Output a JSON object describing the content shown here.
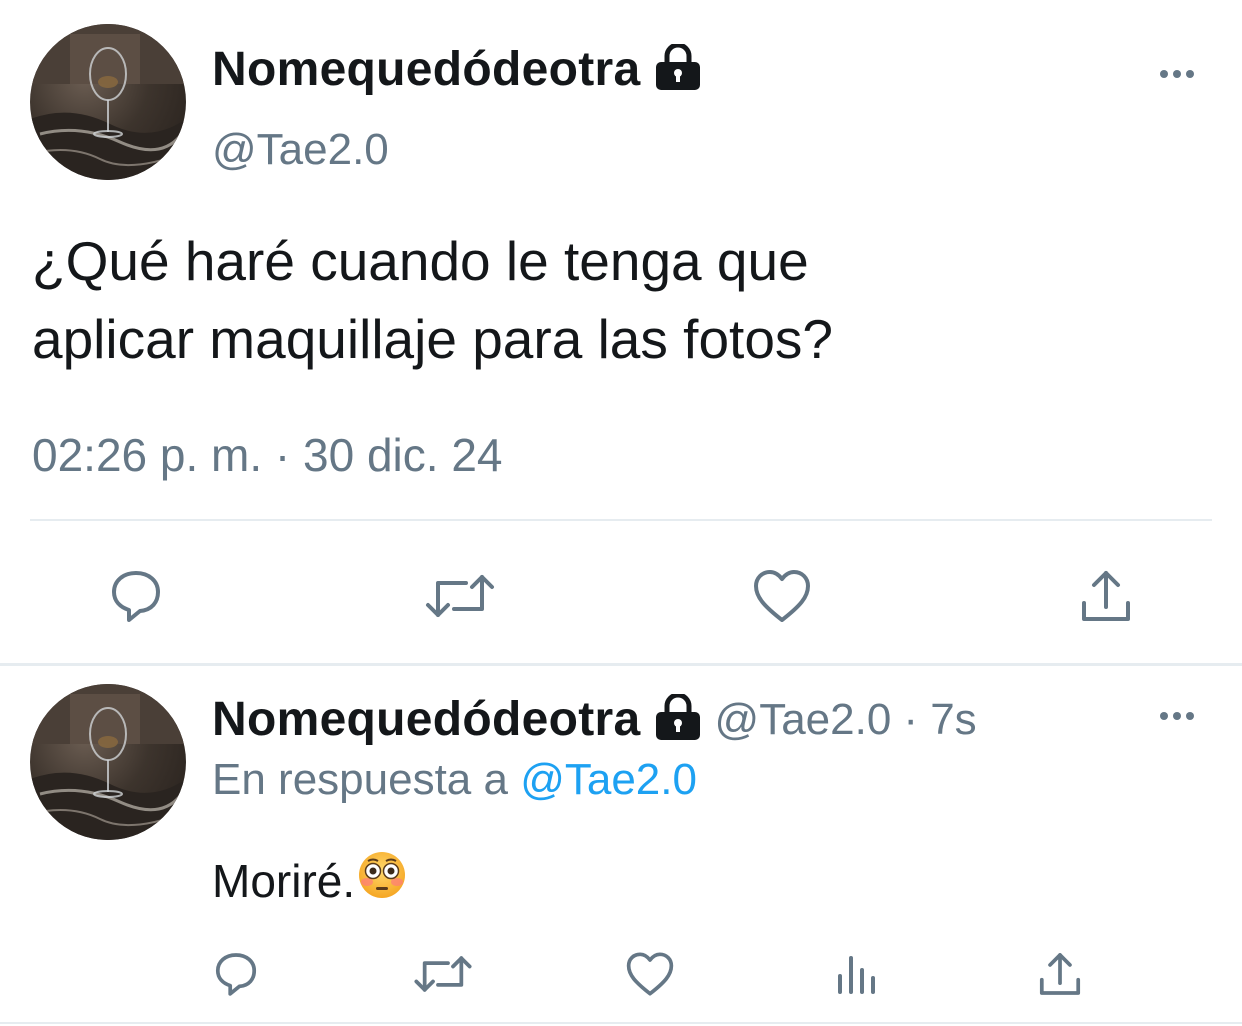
{
  "main_tweet": {
    "display_name": "Nomequedódeotra",
    "handle": "@Tae2.0",
    "text_line1": "¿Qué haré cuando le tenga que",
    "text_line2": "aplicar maquillaje para las fotos?",
    "timestamp": "02:26 p. m. · 30 dic. 24",
    "icons": [
      "lock-icon",
      "more-icon",
      "reply-icon",
      "retweet-icon",
      "like-icon",
      "share-icon"
    ]
  },
  "reply_tweet": {
    "display_name": "Nomequedódeotra",
    "handle": "@Tae2.0",
    "time": "· 7s",
    "replying_prefix": "En respuesta a",
    "replying_to": "@Tae2.0",
    "text": "Moriré.",
    "emoji": "flushed-face",
    "icons": [
      "lock-icon",
      "more-icon",
      "reply-icon",
      "retweet-icon",
      "like-icon",
      "analytics-icon",
      "share-icon"
    ]
  },
  "colors": {
    "text": "#14171a",
    "secondary": "#657786",
    "link": "#1da1f2",
    "divider": "#e6ecf0"
  }
}
